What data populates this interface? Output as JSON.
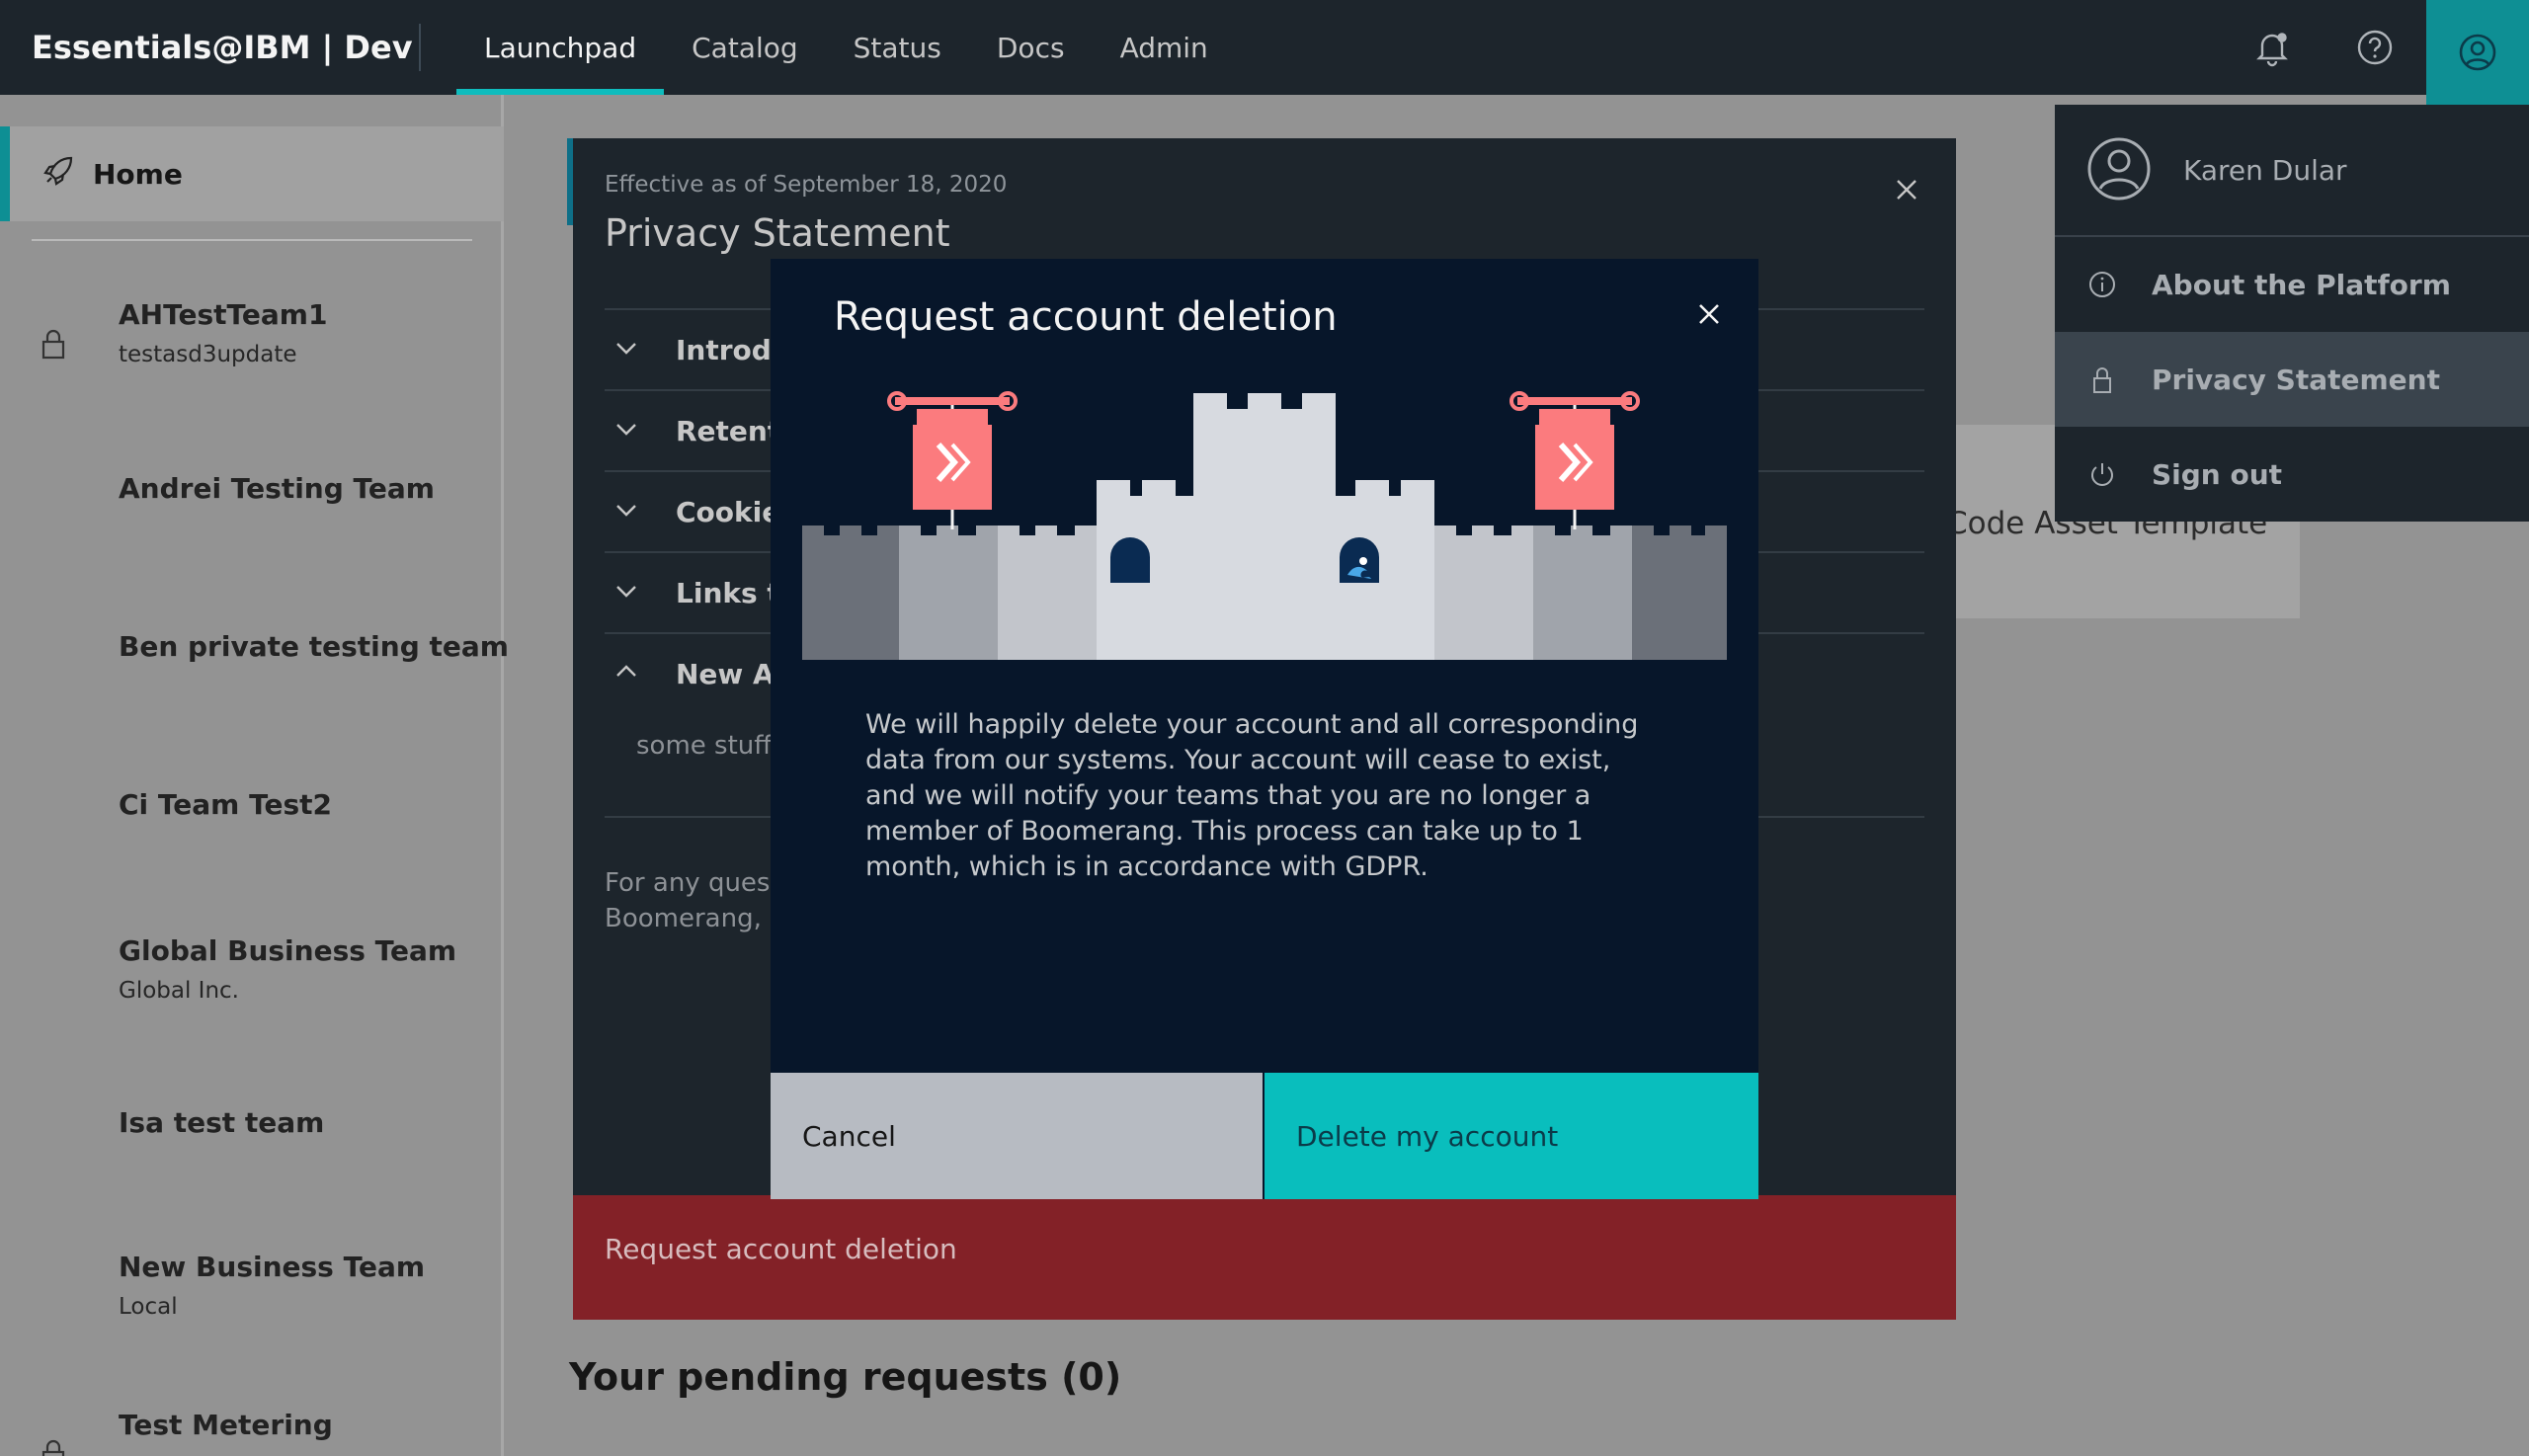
{
  "header": {
    "brand": "Essentials@IBM | Dev",
    "nav": [
      {
        "label": "Launchpad",
        "active": true
      },
      {
        "label": "Catalog"
      },
      {
        "label": "Status"
      },
      {
        "label": "Docs"
      },
      {
        "label": "Admin"
      }
    ],
    "icons": [
      "notification-icon",
      "help-icon",
      "user-icon"
    ]
  },
  "sidebar": {
    "home": "Home",
    "teams": [
      {
        "name": "AHTestTeam1",
        "sub": "testasd3update",
        "locked": true
      },
      {
        "name": "Andrei Testing Team",
        "sub": ""
      },
      {
        "name": "Ben private testing team",
        "sub": ""
      },
      {
        "name": "Ci Team Test2",
        "sub": ""
      },
      {
        "name": "Global Business Team",
        "sub": "Global Inc."
      },
      {
        "name": "Isa test team",
        "sub": ""
      },
      {
        "name": "New Business Team",
        "sub": "Local"
      },
      {
        "name": "Test Metering",
        "sub": "",
        "locked": true
      }
    ]
  },
  "main": {
    "pending_title": "Your pending requests (0)",
    "card_text": "Code Asset Template"
  },
  "privacy_modal": {
    "effective": "Effective as of September 18, 2020",
    "title": "Privacy Statement",
    "sections": [
      {
        "label": "Introdu",
        "expanded": false
      },
      {
        "label": "Retenti",
        "expanded": false
      },
      {
        "label": "Cookies",
        "expanded": false
      },
      {
        "label": "Links to",
        "expanded": false
      },
      {
        "label": "New Ac",
        "expanded": true
      }
    ],
    "expanded_body": "some stuff",
    "contact_text": "For any quest\nBoomerang, p",
    "request_button": "Request account deletion"
  },
  "user_menu": {
    "user_name": "Karen Dular",
    "items": [
      {
        "label": "About the Platform",
        "icon": "info-icon"
      },
      {
        "label": "Privacy Statement",
        "icon": "lock-icon",
        "active": true
      },
      {
        "label": "Sign out",
        "icon": "power-icon"
      }
    ]
  },
  "delete_dialog": {
    "title": "Request account deletion",
    "body": "We will happily delete your account and all corresponding data from our systems. Your account will cease to exist, and we will notify your teams that you are no longer a member of Boomerang. This process can take up to 1 month, which is in accordance with GDPR.",
    "cancel_label": "Cancel",
    "delete_label": "Delete my account"
  },
  "colors": {
    "accent": "#0ebcbd",
    "header_bg": "#1d252c",
    "danger": "#832127",
    "banner": "#fb7b7e"
  }
}
